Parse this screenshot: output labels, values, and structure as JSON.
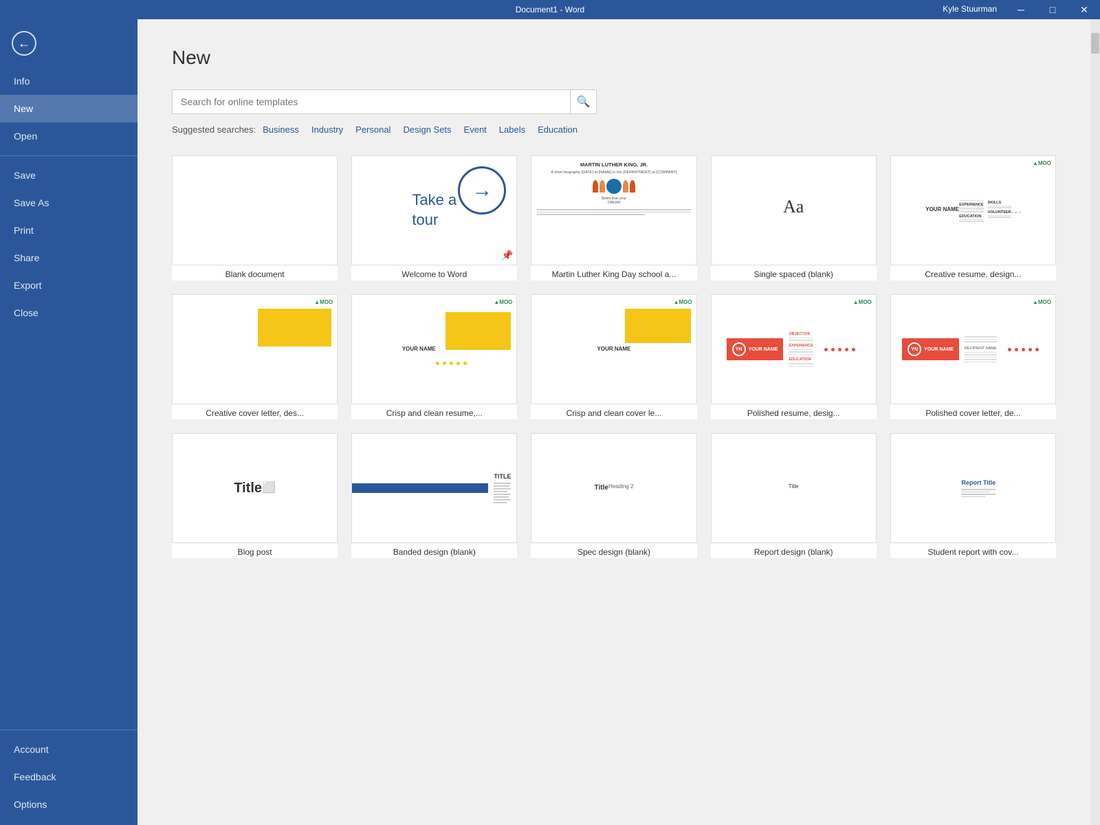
{
  "titlebar": {
    "title": "Document1 - Word",
    "user": "Kyle Stuurman",
    "min_btn": "─",
    "max_btn": "□",
    "close_btn": "✕"
  },
  "sidebar": {
    "back_label": "←",
    "items": [
      {
        "id": "info",
        "label": "Info"
      },
      {
        "id": "new",
        "label": "New"
      },
      {
        "id": "open",
        "label": "Open"
      },
      {
        "id": "save",
        "label": "Save"
      },
      {
        "id": "save-as",
        "label": "Save As"
      },
      {
        "id": "print",
        "label": "Print"
      },
      {
        "id": "share",
        "label": "Share"
      },
      {
        "id": "export",
        "label": "Export"
      },
      {
        "id": "close",
        "label": "Close"
      }
    ],
    "bottom_items": [
      {
        "id": "account",
        "label": "Account"
      },
      {
        "id": "feedback",
        "label": "Feedback"
      },
      {
        "id": "options",
        "label": "Options"
      }
    ]
  },
  "main": {
    "page_title": "New",
    "search": {
      "placeholder": "Search for online templates",
      "button_label": "🔍"
    },
    "suggested": {
      "label": "Suggested searches:",
      "links": [
        "Business",
        "Industry",
        "Personal",
        "Design Sets",
        "Event",
        "Labels",
        "Education"
      ]
    },
    "templates": [
      {
        "id": "blank",
        "label": "Blank document",
        "type": "blank"
      },
      {
        "id": "tour",
        "label": "Welcome to Word",
        "type": "tour",
        "pinnable": true
      },
      {
        "id": "mlk",
        "label": "Martin Luther King Day school a...",
        "type": "mlk"
      },
      {
        "id": "single-spaced",
        "label": "Single spaced (blank)",
        "type": "single-spaced"
      },
      {
        "id": "creative-resume",
        "label": "Creative resume, design...",
        "type": "creative-resume"
      },
      {
        "id": "creative-cover",
        "label": "Creative cover letter, des...",
        "type": "creative-cover"
      },
      {
        "id": "crisp-resume",
        "label": "Crisp and clean resume,...",
        "type": "crisp-resume"
      },
      {
        "id": "crisp-cover",
        "label": "Crisp and clean cover le...",
        "type": "crisp-cover"
      },
      {
        "id": "polished-resume",
        "label": "Polished resume, desig...",
        "type": "polished-resume"
      },
      {
        "id": "polished-cover",
        "label": "Polished cover letter, de...",
        "type": "polished-cover"
      },
      {
        "id": "blog-post",
        "label": "Blog post",
        "type": "blog-post"
      },
      {
        "id": "banded",
        "label": "Banded design (blank)",
        "type": "banded"
      },
      {
        "id": "spec",
        "label": "Spec design (blank)",
        "type": "spec"
      },
      {
        "id": "report",
        "label": "Report design (blank)",
        "type": "report"
      },
      {
        "id": "student-report",
        "label": "Student report with cov...",
        "type": "student-report"
      }
    ]
  }
}
